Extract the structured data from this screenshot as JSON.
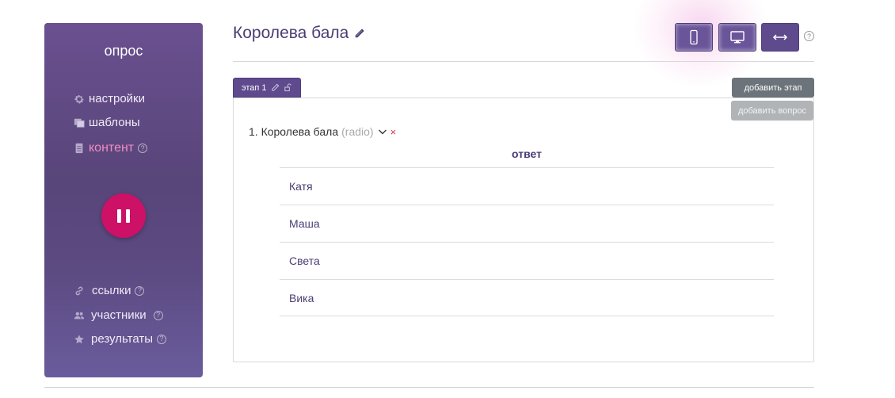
{
  "sidebar": {
    "title": "опрос",
    "items_top": [
      {
        "label": "настройки",
        "icon": "gear-icon"
      },
      {
        "label": "шаблоны",
        "icon": "templates-icon"
      },
      {
        "label": "контент",
        "icon": "document-icon",
        "active": true,
        "help": "?"
      }
    ],
    "pause_icon": "pause-icon",
    "items_bottom": [
      {
        "label": "ссылки",
        "icon": "link-icon",
        "help": "?"
      },
      {
        "label": "участники",
        "icon": "users-icon",
        "help": "?"
      },
      {
        "label": "результаты",
        "icon": "star-icon",
        "help": "?"
      }
    ]
  },
  "header": {
    "title": "Королева бала",
    "view_buttons": [
      "mobile-icon",
      "desktop-icon",
      "resize-arrows-icon"
    ],
    "help": "?"
  },
  "stage": {
    "tab_label": "этап 1",
    "add_stage_label": "добавить этап",
    "add_question_label": "добавить вопрос"
  },
  "question": {
    "number_title": "1. Королева бала",
    "type": "(radio)",
    "delete": "×",
    "answers_header": "ответ",
    "answers": [
      "Катя",
      "Маша",
      "Света",
      "Вика"
    ]
  },
  "colors": {
    "sidebar": "#5c4a82",
    "accent": "#f28cc4",
    "pause": "#cc1166",
    "primary": "#5e4a8c",
    "delete": "#e0314f"
  }
}
